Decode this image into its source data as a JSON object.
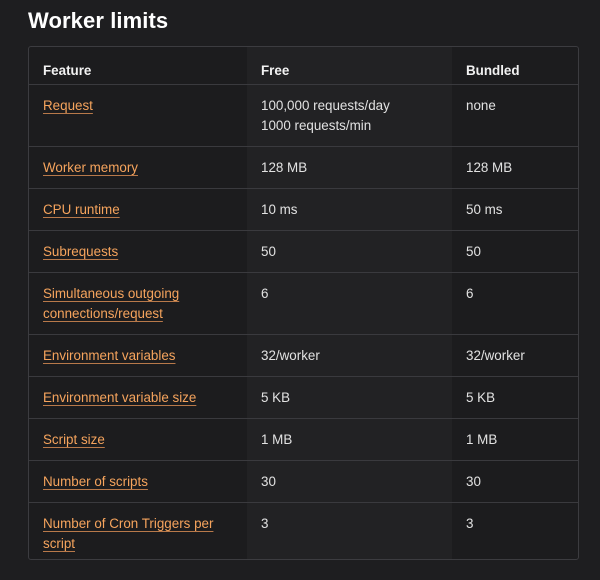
{
  "page": {
    "title": "Worker limits"
  },
  "table": {
    "headers": [
      "Feature",
      "Free",
      "Bundled"
    ],
    "rows": [
      {
        "feature": "Request",
        "free": [
          "100,000 requests/day",
          "1000 requests/min"
        ],
        "bundled": [
          "none"
        ]
      },
      {
        "feature": "Worker memory",
        "free": [
          "128 MB"
        ],
        "bundled": [
          "128 MB"
        ]
      },
      {
        "feature": "CPU runtime",
        "free": [
          "10 ms"
        ],
        "bundled": [
          "50 ms"
        ]
      },
      {
        "feature": "Subrequests",
        "free": [
          "50"
        ],
        "bundled": [
          "50"
        ]
      },
      {
        "feature": "Simultaneous outgoing connections/request",
        "free": [
          "6"
        ],
        "bundled": [
          "6"
        ]
      },
      {
        "feature": "Environment variables",
        "free": [
          "32/worker"
        ],
        "bundled": [
          "32/worker"
        ]
      },
      {
        "feature": "Environment variable size",
        "free": [
          "5 KB"
        ],
        "bundled": [
          "5 KB"
        ]
      },
      {
        "feature": "Script size",
        "free": [
          "1 MB"
        ],
        "bundled": [
          "1 MB"
        ]
      },
      {
        "feature": "Number of scripts",
        "free": [
          "30"
        ],
        "bundled": [
          "30"
        ]
      },
      {
        "feature": "Number of Cron Triggers per script",
        "free": [
          "3"
        ],
        "bundled": [
          "3"
        ]
      }
    ]
  },
  "colors": {
    "background": "#1e1e20",
    "link": "#f6a45d",
    "border": "#3a3a3e"
  }
}
